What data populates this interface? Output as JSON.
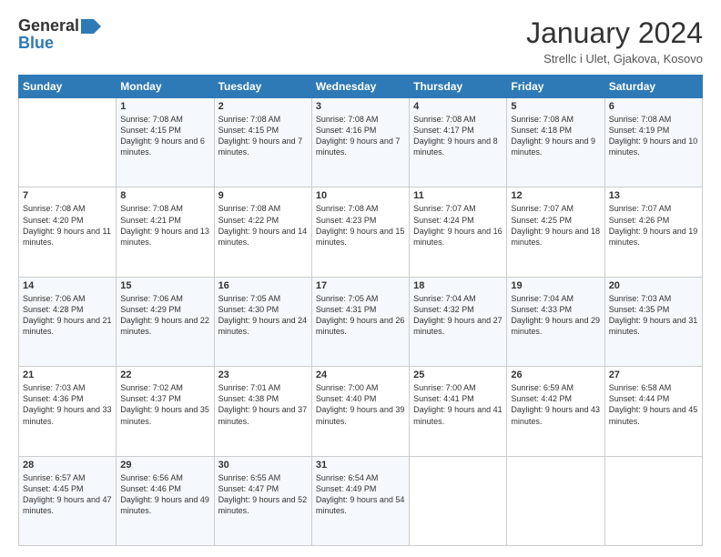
{
  "logo": {
    "general": "General",
    "blue": "Blue"
  },
  "title": "January 2024",
  "subtitle": "Strellc i Ulet, Gjakova, Kosovo",
  "days_of_week": [
    "Sunday",
    "Monday",
    "Tuesday",
    "Wednesday",
    "Thursday",
    "Friday",
    "Saturday"
  ],
  "weeks": [
    [
      {
        "day": "",
        "sunrise": "",
        "sunset": "",
        "daylight": ""
      },
      {
        "day": "1",
        "sunrise": "Sunrise: 7:08 AM",
        "sunset": "Sunset: 4:15 PM",
        "daylight": "Daylight: 9 hours and 6 minutes."
      },
      {
        "day": "2",
        "sunrise": "Sunrise: 7:08 AM",
        "sunset": "Sunset: 4:15 PM",
        "daylight": "Daylight: 9 hours and 7 minutes."
      },
      {
        "day": "3",
        "sunrise": "Sunrise: 7:08 AM",
        "sunset": "Sunset: 4:16 PM",
        "daylight": "Daylight: 9 hours and 7 minutes."
      },
      {
        "day": "4",
        "sunrise": "Sunrise: 7:08 AM",
        "sunset": "Sunset: 4:17 PM",
        "daylight": "Daylight: 9 hours and 8 minutes."
      },
      {
        "day": "5",
        "sunrise": "Sunrise: 7:08 AM",
        "sunset": "Sunset: 4:18 PM",
        "daylight": "Daylight: 9 hours and 9 minutes."
      },
      {
        "day": "6",
        "sunrise": "Sunrise: 7:08 AM",
        "sunset": "Sunset: 4:19 PM",
        "daylight": "Daylight: 9 hours and 10 minutes."
      }
    ],
    [
      {
        "day": "7",
        "sunrise": "Sunrise: 7:08 AM",
        "sunset": "Sunset: 4:20 PM",
        "daylight": "Daylight: 9 hours and 11 minutes."
      },
      {
        "day": "8",
        "sunrise": "Sunrise: 7:08 AM",
        "sunset": "Sunset: 4:21 PM",
        "daylight": "Daylight: 9 hours and 13 minutes."
      },
      {
        "day": "9",
        "sunrise": "Sunrise: 7:08 AM",
        "sunset": "Sunset: 4:22 PM",
        "daylight": "Daylight: 9 hours and 14 minutes."
      },
      {
        "day": "10",
        "sunrise": "Sunrise: 7:08 AM",
        "sunset": "Sunset: 4:23 PM",
        "daylight": "Daylight: 9 hours and 15 minutes."
      },
      {
        "day": "11",
        "sunrise": "Sunrise: 7:07 AM",
        "sunset": "Sunset: 4:24 PM",
        "daylight": "Daylight: 9 hours and 16 minutes."
      },
      {
        "day": "12",
        "sunrise": "Sunrise: 7:07 AM",
        "sunset": "Sunset: 4:25 PM",
        "daylight": "Daylight: 9 hours and 18 minutes."
      },
      {
        "day": "13",
        "sunrise": "Sunrise: 7:07 AM",
        "sunset": "Sunset: 4:26 PM",
        "daylight": "Daylight: 9 hours and 19 minutes."
      }
    ],
    [
      {
        "day": "14",
        "sunrise": "Sunrise: 7:06 AM",
        "sunset": "Sunset: 4:28 PM",
        "daylight": "Daylight: 9 hours and 21 minutes."
      },
      {
        "day": "15",
        "sunrise": "Sunrise: 7:06 AM",
        "sunset": "Sunset: 4:29 PM",
        "daylight": "Daylight: 9 hours and 22 minutes."
      },
      {
        "day": "16",
        "sunrise": "Sunrise: 7:05 AM",
        "sunset": "Sunset: 4:30 PM",
        "daylight": "Daylight: 9 hours and 24 minutes."
      },
      {
        "day": "17",
        "sunrise": "Sunrise: 7:05 AM",
        "sunset": "Sunset: 4:31 PM",
        "daylight": "Daylight: 9 hours and 26 minutes."
      },
      {
        "day": "18",
        "sunrise": "Sunrise: 7:04 AM",
        "sunset": "Sunset: 4:32 PM",
        "daylight": "Daylight: 9 hours and 27 minutes."
      },
      {
        "day": "19",
        "sunrise": "Sunrise: 7:04 AM",
        "sunset": "Sunset: 4:33 PM",
        "daylight": "Daylight: 9 hours and 29 minutes."
      },
      {
        "day": "20",
        "sunrise": "Sunrise: 7:03 AM",
        "sunset": "Sunset: 4:35 PM",
        "daylight": "Daylight: 9 hours and 31 minutes."
      }
    ],
    [
      {
        "day": "21",
        "sunrise": "Sunrise: 7:03 AM",
        "sunset": "Sunset: 4:36 PM",
        "daylight": "Daylight: 9 hours and 33 minutes."
      },
      {
        "day": "22",
        "sunrise": "Sunrise: 7:02 AM",
        "sunset": "Sunset: 4:37 PM",
        "daylight": "Daylight: 9 hours and 35 minutes."
      },
      {
        "day": "23",
        "sunrise": "Sunrise: 7:01 AM",
        "sunset": "Sunset: 4:38 PM",
        "daylight": "Daylight: 9 hours and 37 minutes."
      },
      {
        "day": "24",
        "sunrise": "Sunrise: 7:00 AM",
        "sunset": "Sunset: 4:40 PM",
        "daylight": "Daylight: 9 hours and 39 minutes."
      },
      {
        "day": "25",
        "sunrise": "Sunrise: 7:00 AM",
        "sunset": "Sunset: 4:41 PM",
        "daylight": "Daylight: 9 hours and 41 minutes."
      },
      {
        "day": "26",
        "sunrise": "Sunrise: 6:59 AM",
        "sunset": "Sunset: 4:42 PM",
        "daylight": "Daylight: 9 hours and 43 minutes."
      },
      {
        "day": "27",
        "sunrise": "Sunrise: 6:58 AM",
        "sunset": "Sunset: 4:44 PM",
        "daylight": "Daylight: 9 hours and 45 minutes."
      }
    ],
    [
      {
        "day": "28",
        "sunrise": "Sunrise: 6:57 AM",
        "sunset": "Sunset: 4:45 PM",
        "daylight": "Daylight: 9 hours and 47 minutes."
      },
      {
        "day": "29",
        "sunrise": "Sunrise: 6:56 AM",
        "sunset": "Sunset: 4:46 PM",
        "daylight": "Daylight: 9 hours and 49 minutes."
      },
      {
        "day": "30",
        "sunrise": "Sunrise: 6:55 AM",
        "sunset": "Sunset: 4:47 PM",
        "daylight": "Daylight: 9 hours and 52 minutes."
      },
      {
        "day": "31",
        "sunrise": "Sunrise: 6:54 AM",
        "sunset": "Sunset: 4:49 PM",
        "daylight": "Daylight: 9 hours and 54 minutes."
      },
      {
        "day": "",
        "sunrise": "",
        "sunset": "",
        "daylight": ""
      },
      {
        "day": "",
        "sunrise": "",
        "sunset": "",
        "daylight": ""
      },
      {
        "day": "",
        "sunrise": "",
        "sunset": "",
        "daylight": ""
      }
    ]
  ]
}
